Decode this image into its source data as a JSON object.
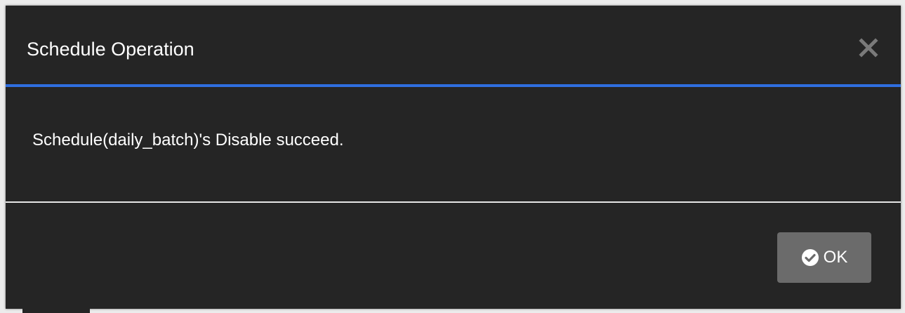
{
  "dialog": {
    "title": "Schedule Operation",
    "message": "Schedule(daily_batch)'s Disable succeed.",
    "ok_label": "OK",
    "close_icon": "close-icon",
    "ok_icon": "check-circle-icon"
  },
  "colors": {
    "background": "#252525",
    "accent": "#2f6ee0",
    "button": "#6b6b6b",
    "text": "#ffffff",
    "close_icon": "#7a7a7a"
  }
}
